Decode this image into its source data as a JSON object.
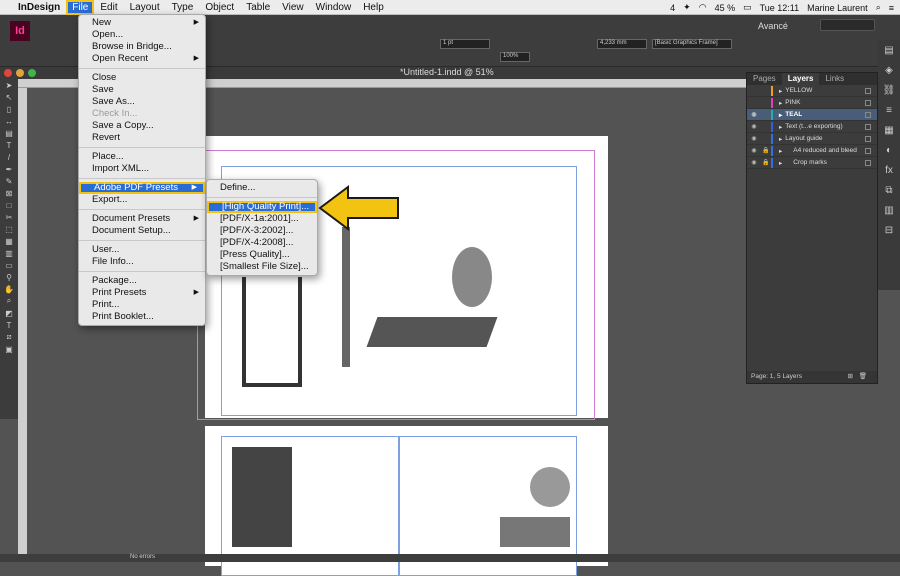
{
  "menubar": {
    "apple": "",
    "app_name": "InDesign",
    "items": [
      "File",
      "Edit",
      "Layout",
      "Type",
      "Object",
      "Table",
      "View",
      "Window",
      "Help"
    ],
    "status": {
      "battery": "45 %",
      "time": "Tue 12:11",
      "user": "Marine Laurent",
      "badge": "4"
    }
  },
  "control_bar": {
    "workspace": "Avancé",
    "style_field": "[Basic Graphics Frame]",
    "stroke": "1 pt",
    "zoom_field": "100%",
    "value_field": "4,233 mm"
  },
  "document_tab": "*Untitled-1.indd @ 51%",
  "file_menu": [
    {
      "label": "New",
      "submenu": true
    },
    {
      "label": "Open..."
    },
    {
      "label": "Browse in Bridge..."
    },
    {
      "label": "Open Recent",
      "submenu": true
    },
    {
      "sep": true
    },
    {
      "label": "Close"
    },
    {
      "label": "Save"
    },
    {
      "label": "Save As..."
    },
    {
      "label": "Check In...",
      "disabled": true
    },
    {
      "label": "Save a Copy..."
    },
    {
      "label": "Revert"
    },
    {
      "sep": true
    },
    {
      "label": "Place..."
    },
    {
      "label": "Import XML..."
    },
    {
      "sep": true
    },
    {
      "label": "Adobe PDF Presets",
      "submenu": true,
      "highlight": true
    },
    {
      "label": "Export..."
    },
    {
      "sep": true
    },
    {
      "label": "Document Presets",
      "submenu": true
    },
    {
      "label": "Document Setup..."
    },
    {
      "sep": true
    },
    {
      "label": "User..."
    },
    {
      "label": "File Info..."
    },
    {
      "sep": true
    },
    {
      "label": "Package..."
    },
    {
      "label": "Print Presets",
      "submenu": true
    },
    {
      "label": "Print..."
    },
    {
      "label": "Print Booklet..."
    }
  ],
  "pdf_submenu": [
    {
      "label": "Define..."
    },
    {
      "sep": true
    },
    {
      "label": "[High Quality Print]...",
      "highlight": true
    },
    {
      "label": "[PDF/X-1a:2001]..."
    },
    {
      "label": "[PDF/X-3:2002]..."
    },
    {
      "label": "[PDF/X-4:2008]..."
    },
    {
      "label": "[Press Quality]..."
    },
    {
      "label": "[Smallest File Size]..."
    }
  ],
  "callout_color": "#f3c312",
  "layers_panel": {
    "tabs": [
      "Pages",
      "Layers",
      "Links"
    ],
    "active_tab": "Layers",
    "rows": [
      {
        "name": "YELLOW",
        "color": "#f0a020",
        "eye": false
      },
      {
        "name": "PINK",
        "color": "#e040c0",
        "eye": false
      },
      {
        "name": "TEAL",
        "color": "#20b0b0",
        "eye": true,
        "selected": true
      },
      {
        "name": "Text (t...e exporting)",
        "color": "#3060e0",
        "eye": true
      },
      {
        "name": "Layout guide",
        "color": "#3070e0",
        "eye": true
      },
      {
        "name": "A4 reduced and bleed",
        "color": "#3070e0",
        "eye": true,
        "locked": true
      },
      {
        "name": "Crop marks",
        "color": "#3070e0",
        "eye": true,
        "locked": true
      }
    ],
    "footer": "Page: 1, 5 Layers"
  },
  "statusbar": {
    "preflight": "No errors"
  }
}
